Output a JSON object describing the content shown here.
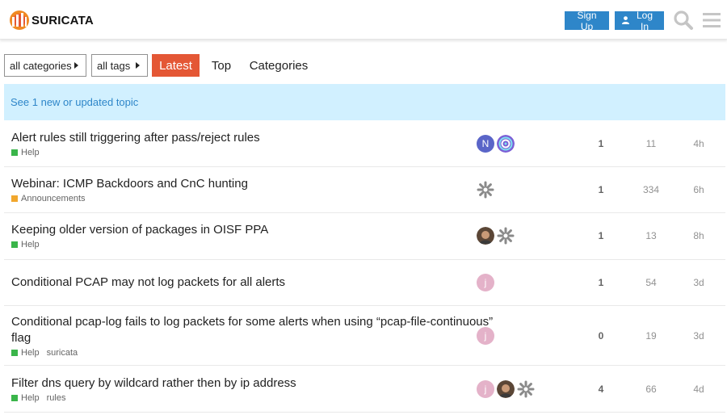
{
  "header": {
    "logo_text": "SURICATA",
    "signup_label": "Sign Up",
    "login_label": "Log In",
    "search_icon": "search-icon",
    "menu_icon": "hamburger-icon",
    "accent_color": "#2e86c9"
  },
  "nav": {
    "categories_dropdown": "all categories",
    "tags_dropdown": "all tags",
    "tabs": [
      "Latest",
      "Top",
      "Categories"
    ],
    "active_tab_color": "#e45735"
  },
  "banner": {
    "text": "See 1 new or updated topic"
  },
  "topics": [
    {
      "title": "Alert rules still triggering after pass/reject rules",
      "category": "Help",
      "category_color": "#3ab54a",
      "tags": [],
      "posters": [
        "N",
        "spiral"
      ],
      "replies": "1",
      "views": "11",
      "activity": "4h"
    },
    {
      "title": "Webinar: ICMP Backdoors and CnC hunting",
      "category": "Announcements",
      "category_color": "#f1a72d",
      "tags": [],
      "posters": [
        "gear"
      ],
      "replies": "1",
      "views": "334",
      "activity": "6h"
    },
    {
      "title": "Keeping older version of packages in OISF PPA",
      "category": "Help",
      "category_color": "#3ab54a",
      "tags": [],
      "posters": [
        "photo",
        "gear"
      ],
      "replies": "1",
      "views": "13",
      "activity": "8h"
    },
    {
      "title": "Conditional PCAP may not log packets for all alerts",
      "category": "",
      "category_color": "",
      "tags": [],
      "posters": [
        "j"
      ],
      "replies": "1",
      "views": "54",
      "activity": "3d"
    },
    {
      "title": "Conditional pcap-log fails to log packets for some alerts when using “pcap-file-continuous”",
      "title_line2": "flag",
      "category": "Help",
      "category_color": "#3ab54a",
      "tags": [
        "suricata"
      ],
      "posters": [
        "j"
      ],
      "replies": "0",
      "views": "19",
      "activity": "3d"
    },
    {
      "title": "Filter dns query by wildcard rather then by ip address",
      "category": "Help",
      "category_color": "#3ab54a",
      "tags": [
        "rules"
      ],
      "posters": [
        "j",
        "photo",
        "gear"
      ],
      "replies": "4",
      "views": "66",
      "activity": "4d"
    }
  ]
}
